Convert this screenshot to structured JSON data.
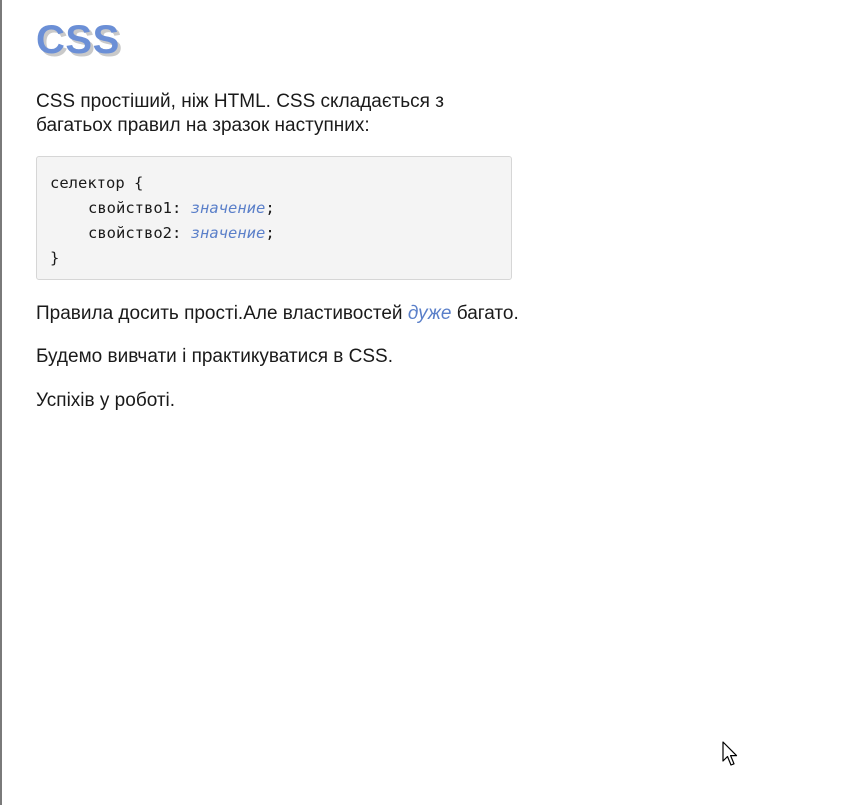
{
  "heading": "CSS",
  "intro": {
    "line1": "CSS простіший, ніж HTML. CSS складається з",
    "line2": "багатьох правил на зразок наступних:"
  },
  "code": {
    "selector_line": "селектор {",
    "prop1_name": "свойство1: ",
    "prop1_value": "значение",
    "prop2_name": "свойство2: ",
    "prop2_value": "значение",
    "semicolon": ";",
    "closing": "}"
  },
  "paragraphs": {
    "p1_before": "Правила досить прості.Але властивостей ",
    "p1_emph": "дуже",
    "p1_after": " багато.",
    "p2": "Будемо вивчати і практикуватися в CSS.",
    "p3": "Успіхів у роботі."
  },
  "colors": {
    "heading": "#6b8fd6",
    "accent": "#5a7fc9",
    "code_bg": "#f4f4f4"
  },
  "icons": {
    "cursor": "mouse-pointer-icon"
  }
}
